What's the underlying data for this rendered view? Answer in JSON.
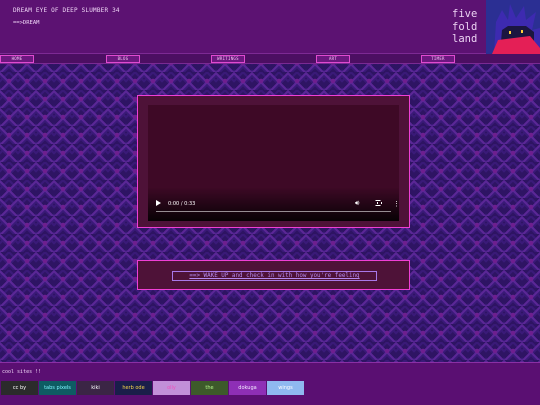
{
  "header": {
    "title": "DREAM EYE OF DEEP SLUMBER 34",
    "dream_link": "==>DREAM",
    "logo": "five fold land",
    "logo_lines": [
      "five",
      "fold",
      "land"
    ]
  },
  "nav": {
    "items": [
      "HOME",
      "BLOG",
      "WRITINGS",
      "ART",
      "TIMER"
    ]
  },
  "video": {
    "time": "0:00 / 0:33",
    "progress": 0.0,
    "icons": [
      "play-icon",
      "volume-icon",
      "fullscreen-icon",
      "more-options-icon"
    ]
  },
  "wake": {
    "link": "==> WAKE UP and check in with how you're feeling"
  },
  "footer": {
    "label": "cool sites !!",
    "badges": [
      {
        "label": "cc by",
        "bg": "#2b2b2b",
        "fg": "#ffffff"
      },
      {
        "label": "tabs pixels",
        "bg": "#0e5c63",
        "fg": "#7ff5ff"
      },
      {
        "label": "kiki",
        "bg": "#3b2545",
        "fg": "#ffffff"
      },
      {
        "label": "herb ode",
        "bg": "#1a1e4a",
        "fg": "#f5d54a"
      },
      {
        "label": "olly",
        "bg": "#c28fd9",
        "fg": "#f04fbd"
      },
      {
        "label": "the",
        "bg": "#3d5a2a",
        "fg": "#b6f58a"
      },
      {
        "label": "dokuga",
        "bg": "#8e2fb6",
        "fg": "#f2e8ff"
      },
      {
        "label": "wings",
        "bg": "#8fb8f0",
        "fg": "#ffffff"
      }
    ]
  },
  "colors": {
    "accent": "#ef3fd5",
    "header_bg": "#5c1272",
    "panel_bg": "#4e1238",
    "link": "#b48af0"
  }
}
